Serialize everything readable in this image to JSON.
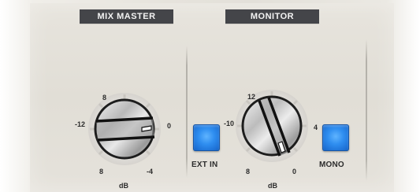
{
  "mix_master": {
    "title": "MIX MASTER",
    "knob": {
      "scale": {
        "top": "8",
        "left": "-12",
        "right": "0",
        "bottom_left": "8",
        "bottom_right": "-4",
        "unit": "dB"
      }
    }
  },
  "monitor": {
    "title": "MONITOR",
    "knob": {
      "scale": {
        "top": "12",
        "left": "-10",
        "right": "4",
        "bottom_left": "8",
        "bottom_right": "0",
        "unit": "dB"
      }
    },
    "ext_in_button": {
      "label": "EXT IN"
    },
    "mono_button": {
      "label": "MONO"
    }
  },
  "colors": {
    "header_bg": "#444549",
    "button_blue": "#2f8ef0",
    "panel_bg": "#e3e0d9"
  }
}
